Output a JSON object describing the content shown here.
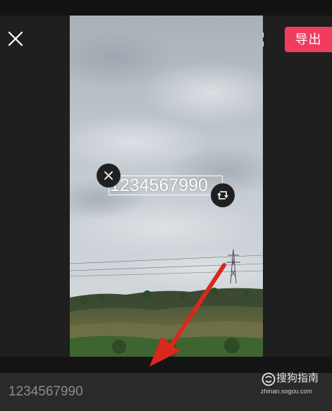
{
  "header": {
    "export_label": "导出",
    "close_icon": "close-icon",
    "fullscreen_icon": "fullscreen-icon"
  },
  "canvas": {
    "overlay_text": "1234567990",
    "delete_icon": "close-icon",
    "rotate_icon": "rotate-scale-icon"
  },
  "input": {
    "value": "1234567990"
  },
  "watermark": {
    "title": "搜狗指南",
    "url": "zhinan.sogou.com"
  },
  "colors": {
    "accent": "#f03d5f",
    "annotation_arrow": "#d9281c",
    "background": "#1f1f1f"
  }
}
